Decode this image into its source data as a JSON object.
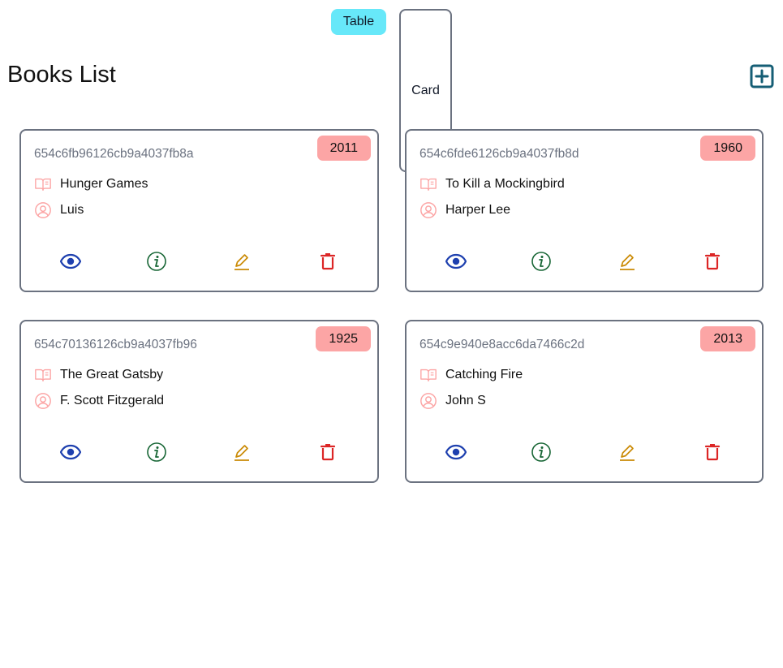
{
  "view_toggle": {
    "table_label": "Table",
    "card_label": "Card"
  },
  "page": {
    "title": "Books List"
  },
  "colors": {
    "toggle_bg": "#67e8f9",
    "badge_bg": "#fca5a5",
    "add_icon": "#155e75",
    "view_icon": "#1e40af",
    "info_icon": "#166534",
    "edit_icon": "#ca8a04",
    "delete_icon": "#dc2626",
    "meta_icon": "#fca5a5"
  },
  "books": [
    {
      "id": "654c6fb96126cb9a4037fb8a",
      "year": "2011",
      "title": "Hunger Games",
      "author": "Luis"
    },
    {
      "id": "654c6fde6126cb9a4037fb8d",
      "year": "1960",
      "title": "To Kill a Mockingbird",
      "author": "Harper Lee"
    },
    {
      "id": "654c70136126cb9a4037fb96",
      "year": "1925",
      "title": "The Great Gatsby",
      "author": "F. Scott Fitzgerald"
    },
    {
      "id": "654c9e940e8acc6da7466c2d",
      "year": "2013",
      "title": "Catching Fire",
      "author": "John S"
    }
  ],
  "card_actions": [
    "eye-icon",
    "info-icon",
    "pencil-icon",
    "trash-icon"
  ]
}
